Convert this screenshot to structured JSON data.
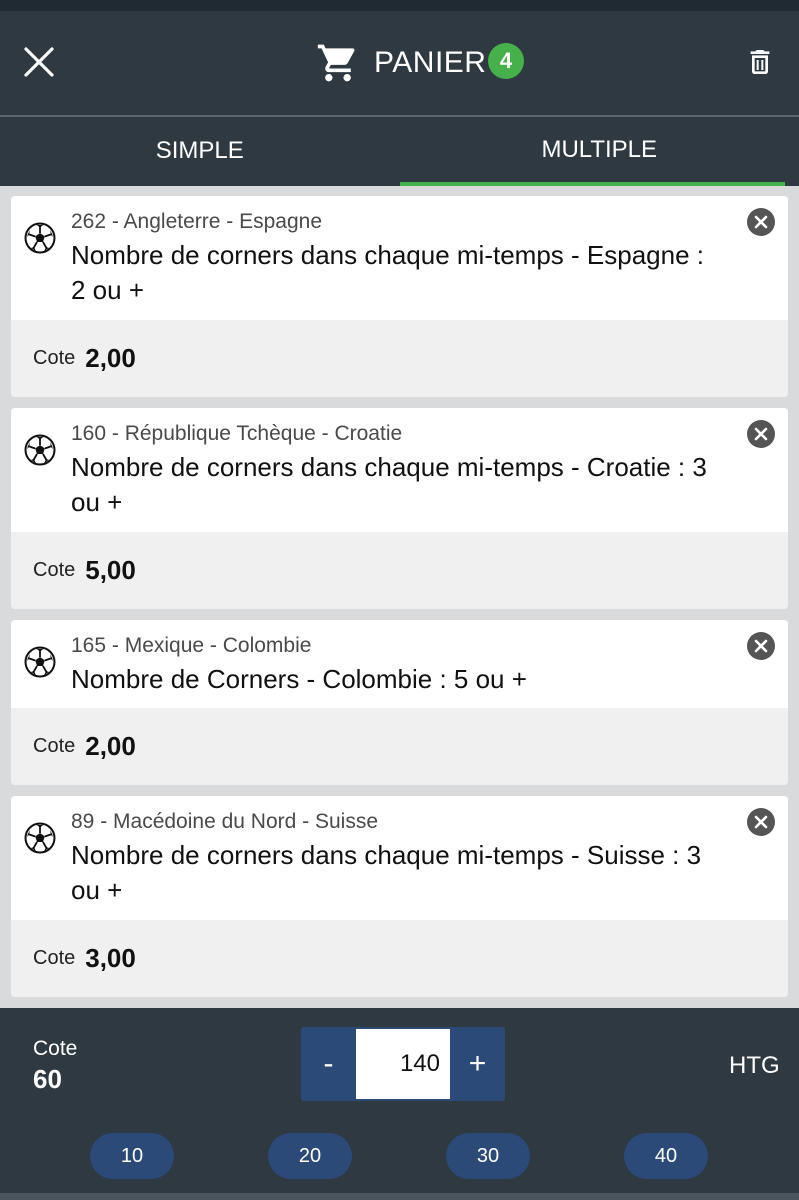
{
  "header": {
    "title": "PANIER",
    "badge_count": "4"
  },
  "tabs": [
    {
      "label": "SIMPLE",
      "active": false
    },
    {
      "label": "MULTIPLE",
      "active": true
    }
  ],
  "bets": [
    {
      "match": "262 - Angleterre - Espagne",
      "market": "Nombre de corners dans chaque mi-temps - Espagne : 2 ou +",
      "odds_label": "Cote",
      "odds": "2,00"
    },
    {
      "match": "160 - République Tchèque - Croatie",
      "market": "Nombre de corners dans chaque mi-temps - Croatie : 3 ou +",
      "odds_label": "Cote",
      "odds": "5,00"
    },
    {
      "match": "165 - Mexique - Colombie",
      "market": "Nombre de Corners - Colombie : 5 ou +",
      "odds_label": "Cote",
      "odds": "2,00"
    },
    {
      "match": "89 - Macédoine du Nord - Suisse",
      "market": "Nombre de corners dans chaque mi-temps - Suisse : 3 ou +",
      "odds_label": "Cote",
      "odds": "3,00"
    }
  ],
  "footer": {
    "total_odds_label": "Cote",
    "total_odds": "60",
    "stake_minus": "-",
    "stake_value": "140",
    "stake_plus": "+",
    "currency": "HTG",
    "quick_amounts": [
      "10",
      "20",
      "30",
      "40"
    ]
  },
  "colors": {
    "header_bg": "#2e3942",
    "accent_green": "#46b14a",
    "button_blue": "#2b4a78"
  },
  "icons": {
    "close": "close-icon",
    "cart": "cart-icon",
    "trash": "trash-icon",
    "ball": "soccer-ball-icon",
    "remove": "remove-bet-icon"
  }
}
